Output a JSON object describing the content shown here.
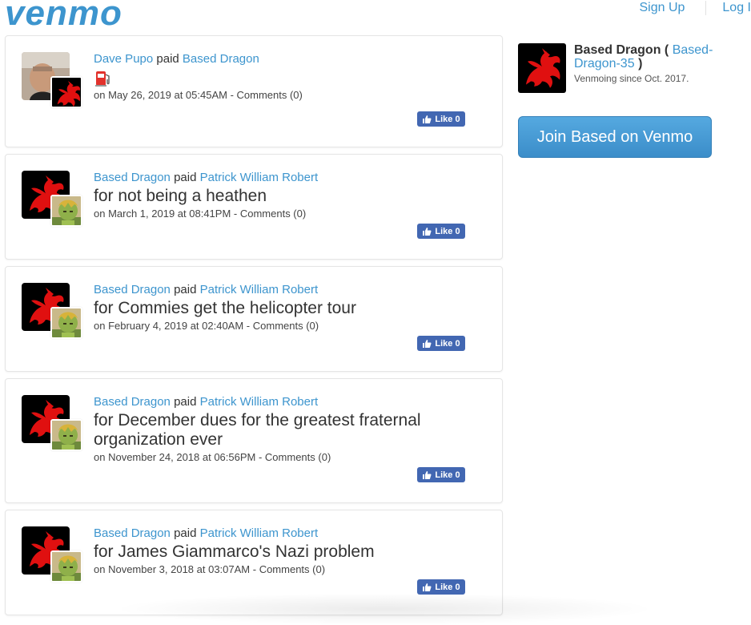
{
  "brand": {
    "logo_text": "venmo",
    "accent": "#3d95ce"
  },
  "topnav": {
    "sign_up": "Sign Up",
    "log_in": "Log I"
  },
  "profile": {
    "name": "Based Dragon",
    "paren_open": "(",
    "handle": "Based-Dragon-35",
    "paren_close": ")",
    "since": "Venmoing since Oct. 2017.",
    "join_label": "Join Based on Venmo"
  },
  "like_label": "Like 0",
  "feed": [
    {
      "actor": "Dave Pupo",
      "verb": "paid",
      "target": "Based Dragon",
      "note": "",
      "emoji_icon": "gas-pump-icon",
      "date": "on May 26, 2019 at 05:45AM",
      "comments": "Comments (0)"
    },
    {
      "actor": "Based Dragon",
      "verb": "paid",
      "target": "Patrick William Robert",
      "note": "for not being a heathen",
      "date": "on March 1, 2019 at 08:41PM",
      "comments": "Comments (0)"
    },
    {
      "actor": "Based Dragon",
      "verb": "paid",
      "target": "Patrick William Robert",
      "note": "for Commies get the helicopter tour",
      "date": "on February 4, 2019 at 02:40AM",
      "comments": "Comments (0)"
    },
    {
      "actor": "Based Dragon",
      "verb": "paid",
      "target": "Patrick William Robert",
      "note": "for December dues for the greatest fraternal organization ever",
      "date": "on November 24, 2018 at 06:56PM",
      "comments": "Comments (0)"
    },
    {
      "actor": "Based Dragon",
      "verb": "paid",
      "target": "Patrick William Robert",
      "note": "for James Giammarco's Nazi problem",
      "date": "on November 3, 2018 at 03:07AM",
      "comments": "Comments (0)"
    }
  ]
}
